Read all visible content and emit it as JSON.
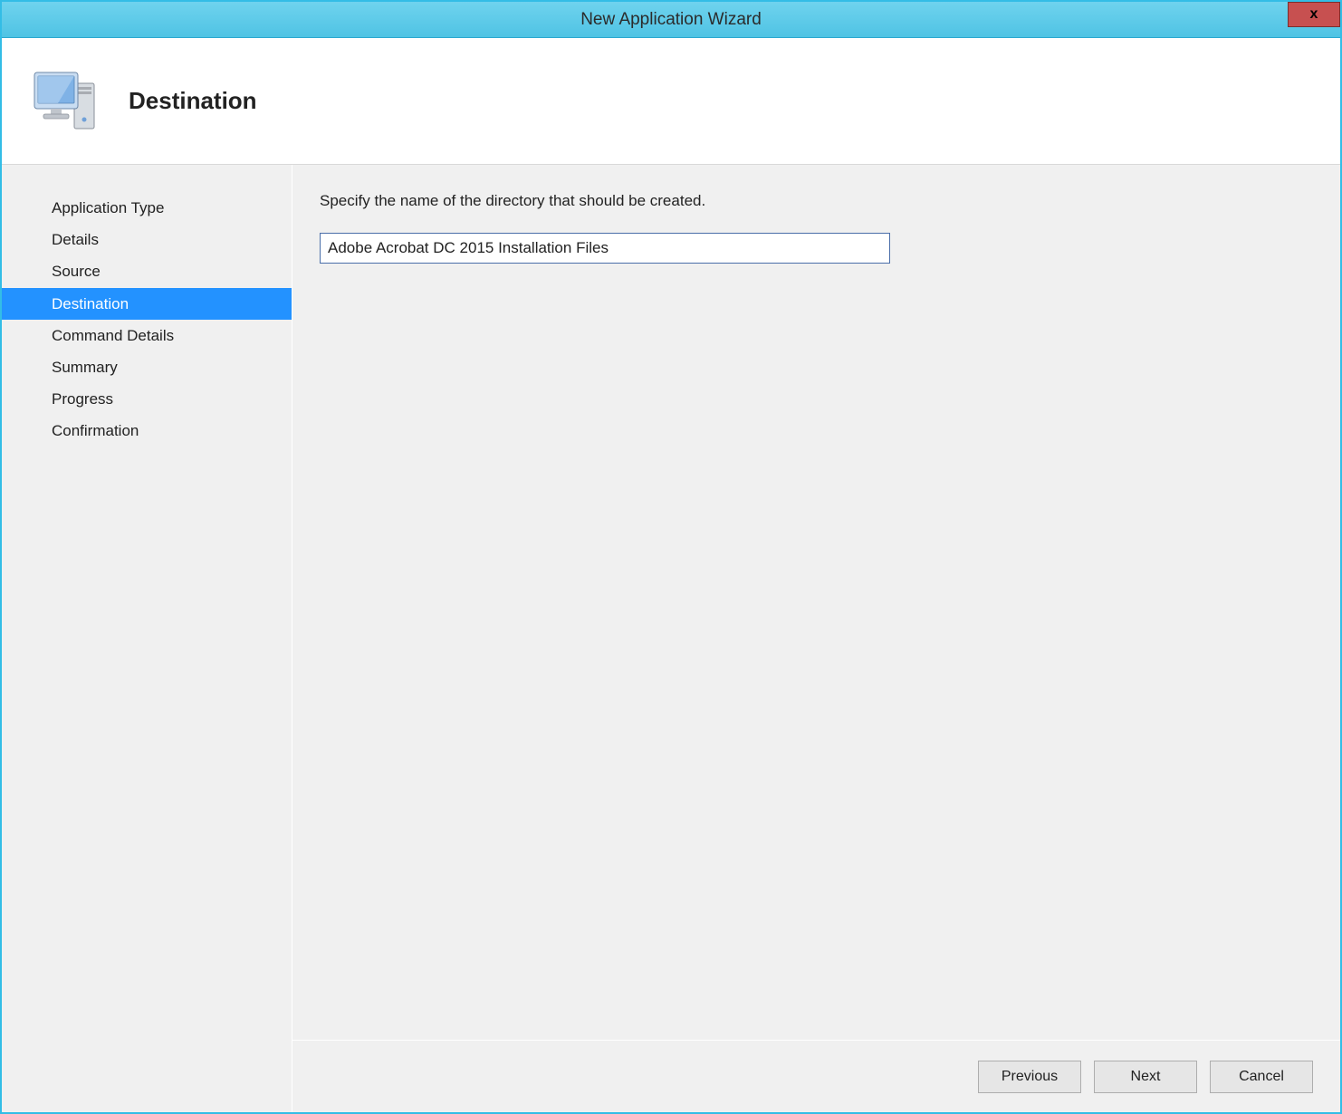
{
  "titlebar": {
    "title": "New Application Wizard",
    "close_label": "x"
  },
  "header": {
    "title": "Destination",
    "icon": "computer-icon"
  },
  "sidebar": {
    "items": [
      {
        "label": "Application Type",
        "active": false
      },
      {
        "label": "Details",
        "active": false
      },
      {
        "label": "Source",
        "active": false
      },
      {
        "label": "Destination",
        "active": true
      },
      {
        "label": "Command Details",
        "active": false
      },
      {
        "label": "Summary",
        "active": false
      },
      {
        "label": "Progress",
        "active": false
      },
      {
        "label": "Confirmation",
        "active": false
      }
    ]
  },
  "main": {
    "instruction": "Specify the name of the directory that should be created.",
    "directory_value": "Adobe Acrobat DC 2015 Installation Files"
  },
  "footer": {
    "previous_label": "Previous",
    "next_label": "Next",
    "cancel_label": "Cancel"
  }
}
